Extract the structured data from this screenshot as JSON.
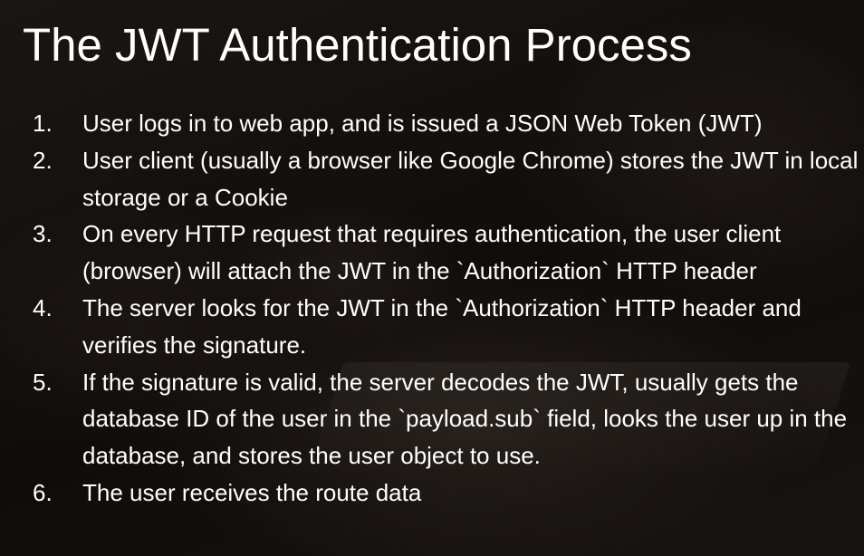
{
  "slide": {
    "title": "The JWT Authentication Process",
    "steps": [
      {
        "number": "1.",
        "text": "User logs in to web app, and is issued a JSON Web Token (JWT)"
      },
      {
        "number": "2.",
        "text": "User client (usually a browser like Google Chrome) stores the JWT in local storage or a Cookie"
      },
      {
        "number": "3.",
        "text": "On every HTTP request that requires authentication, the user client (browser) will attach the JWT in the `Authorization` HTTP header"
      },
      {
        "number": "4.",
        "text": "The server looks for the JWT in the `Authorization` HTTP header and verifies the signature."
      },
      {
        "number": "5.",
        "text": "If the signature is valid, the server decodes the JWT, usually gets the database ID of the user in the `payload.sub` field, looks the user up in the database, and stores the user object to use."
      },
      {
        "number": "6.",
        "text": "The user receives the route data"
      }
    ]
  },
  "colors": {
    "text": "#ffffff",
    "background": "#120f0d"
  }
}
